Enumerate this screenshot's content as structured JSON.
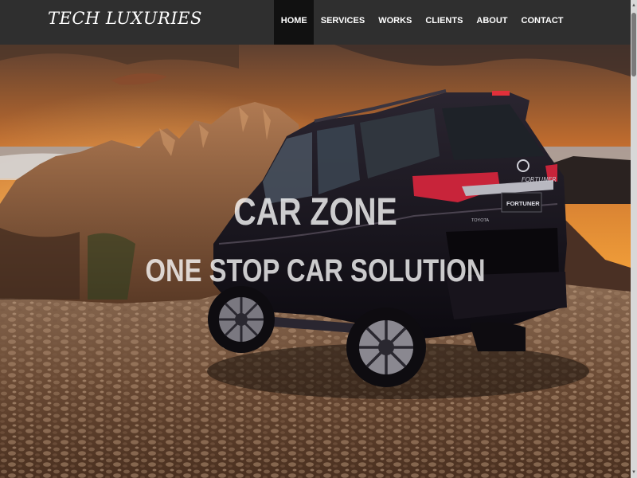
{
  "brand": {
    "name": "TECH LUXURIES"
  },
  "nav": {
    "items": [
      {
        "label": "HOME",
        "active": true
      },
      {
        "label": "SERVICES",
        "active": false
      },
      {
        "label": "WORKS",
        "active": false
      },
      {
        "label": "CLIENTS",
        "active": false
      },
      {
        "label": "ABOUT",
        "active": false
      },
      {
        "label": "CONTACT",
        "active": false
      }
    ]
  },
  "hero": {
    "title": "CAR ZONE",
    "subtitle": "ONE STOP CAR SOLUTION",
    "vehicle": {
      "badge_brand": "TOYOTA",
      "model_plate": "FORTUNER",
      "model_script": "FORTUNER"
    }
  },
  "colors": {
    "navbar": "#2f2f2f",
    "active_nav": "#111111",
    "text": "#ffffff",
    "sky_top": "#6a4a32",
    "sunset": "#f4a23a",
    "car": "#141018"
  }
}
